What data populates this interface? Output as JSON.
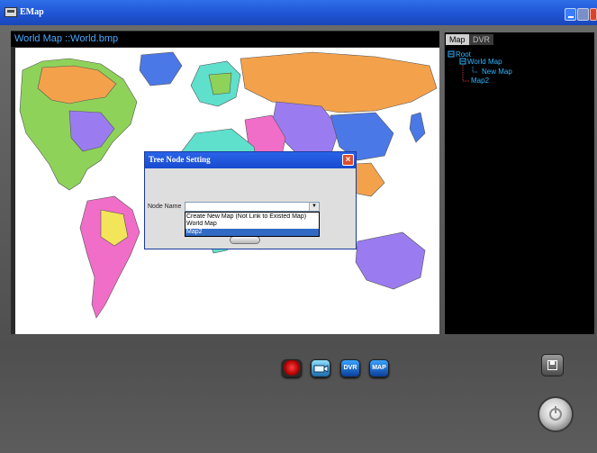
{
  "window": {
    "title": "EMap",
    "icon": "emap-app-icon"
  },
  "map": {
    "title": "World Map ::World.bmp",
    "continent_colors": [
      "#8fd25a",
      "#f3a24b",
      "#9a7cf0",
      "#4a78e6",
      "#f06ec8",
      "#f3e55a",
      "#5ee0cc"
    ]
  },
  "tree": {
    "tabs": [
      {
        "label": "Map"
      },
      {
        "label": "DVR"
      }
    ],
    "nodes": [
      {
        "label": "Root"
      },
      {
        "label": "World Map"
      },
      {
        "label": "New Map"
      },
      {
        "label": "Map2"
      }
    ]
  },
  "dialog": {
    "title": "Tree Node Setting",
    "node_name_label": "Node Name",
    "node_name_value": "",
    "options": [
      {
        "label": "Create New Map (Not Link to Existed Map)"
      },
      {
        "label": "World Map"
      },
      {
        "label": "Map2",
        "selected": true
      }
    ]
  },
  "toolbar": {
    "alarm_icon": "alarm-light-icon",
    "camera_icon": "camera-icon",
    "dvr_label": "DVR",
    "map_label": "MAP"
  },
  "controls": {
    "save_icon": "floppy-disk-icon",
    "power_icon": "power-icon"
  }
}
